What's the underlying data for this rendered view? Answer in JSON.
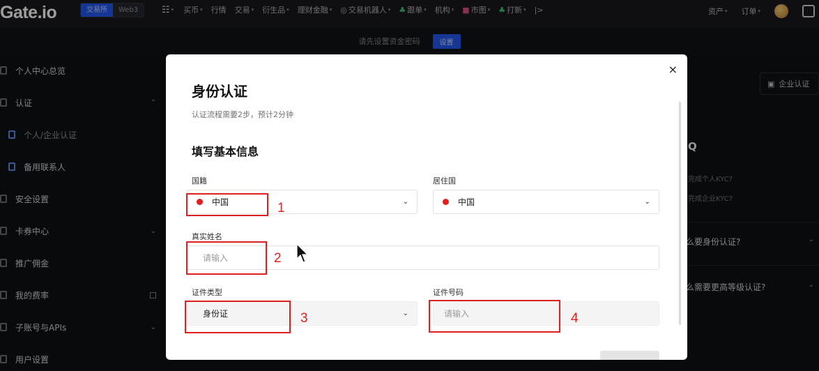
{
  "brand": {
    "logo_text": "Gate.io"
  },
  "topnav": {
    "mode_exchange": "交易所",
    "mode_web3": "Web3",
    "items": [
      "买币",
      "行情",
      "交易",
      "衍生品",
      "理财金融",
      "交易机器人",
      "跟单",
      "机构",
      "市图",
      "打新",
      "|>"
    ],
    "right_items": [
      "资产",
      "订单"
    ]
  },
  "notice": {
    "text": "请先设置资金密码",
    "button": "设置"
  },
  "sidebar": {
    "items": [
      {
        "label": "个人中心总览"
      },
      {
        "label": "认证"
      },
      {
        "label": "个人/企业认证"
      },
      {
        "label": "备用联系人"
      },
      {
        "label": "安全设置"
      },
      {
        "label": "卡券中心"
      },
      {
        "label": "推广佣金"
      },
      {
        "label": "我的费率"
      },
      {
        "label": "子账号与APIs"
      },
      {
        "label": "用户设置"
      }
    ]
  },
  "right_panel": {
    "enterprise_button": "企业认证",
    "faq_title": "Q",
    "faq_links": [
      "完成个人KYC?",
      "完成企业KYC?"
    ],
    "faq_questions": [
      "么要身份认证?",
      "么需要更高等级认证?"
    ]
  },
  "modal": {
    "close_glyph": "×",
    "title": "身份认证",
    "subtitle": "认证流程需要2步，预计2分钟",
    "section_title": "填写基本信息",
    "nationality": {
      "label": "国籍",
      "value": "中国"
    },
    "residence": {
      "label": "居住国",
      "value": "中国"
    },
    "real_name": {
      "label": "真实姓名",
      "placeholder": "请输入"
    },
    "id_type": {
      "label": "证件类型",
      "value": "身份证"
    },
    "id_number": {
      "label": "证件号码",
      "placeholder": "请输入"
    }
  },
  "annotations": [
    "1",
    "2",
    "3",
    "4"
  ],
  "colors": {
    "accent": "#2354e6",
    "annotation": "#e02020",
    "flag": "#e02020"
  }
}
